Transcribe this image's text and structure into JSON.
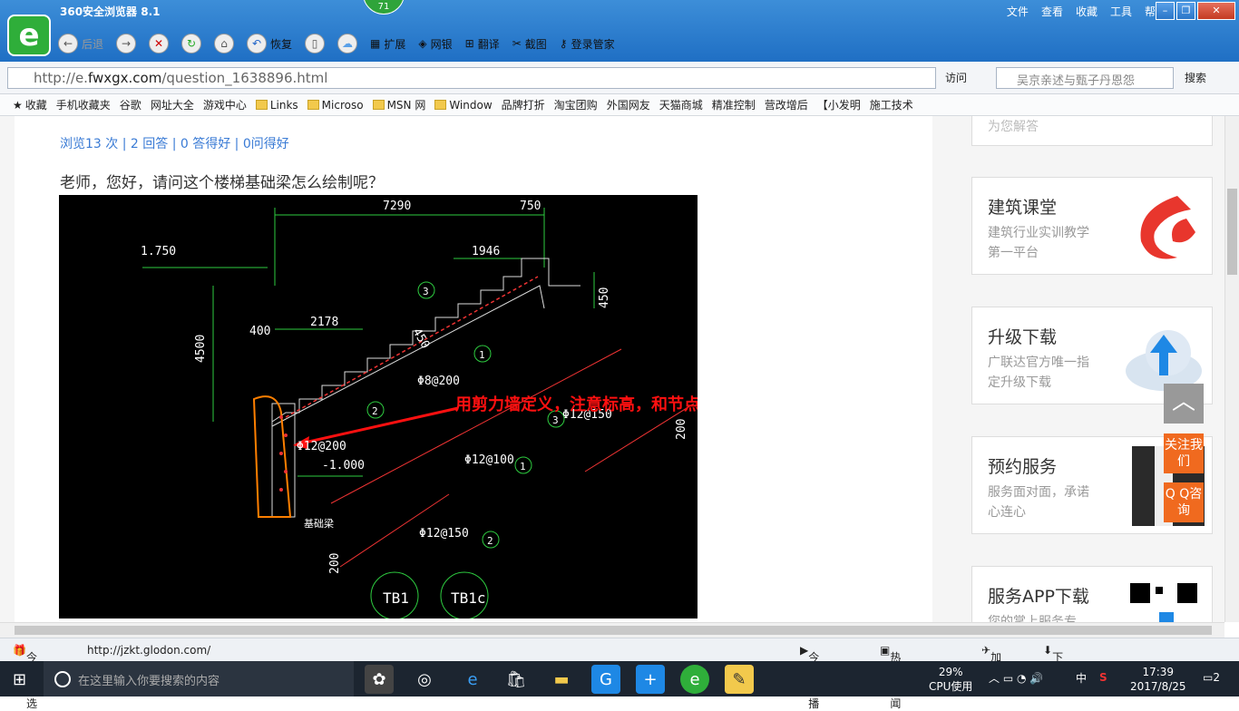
{
  "browser": {
    "title": "360安全浏览器 8.1",
    "badge": "71",
    "menu": [
      "文件",
      "查看",
      "收藏",
      "工具",
      "帮助"
    ],
    "toolbar": {
      "back": "后退",
      "restore": "恢复",
      "extend": "扩展",
      "bank": "网银",
      "translate": "翻译",
      "screenshot": "截图",
      "login": "登录管家"
    },
    "url_domain": "http://e.",
    "url_host": "fwxgx.com",
    "url_path": "/question_1638896.html",
    "visit": "访问",
    "search_placeholder": "吴京亲述与甄子丹恩怨",
    "search_button": "搜索"
  },
  "favorites": [
    "收藏",
    "手机收藏夹",
    "谷歌",
    "网址大全",
    "游戏中心",
    "Links",
    "Microso",
    "MSN 网",
    "Window",
    "品牌打折",
    "淘宝团购",
    "外国网友",
    "天猫商城",
    "精准控制",
    "营改增后",
    "【小发明",
    "施工技术"
  ],
  "question": {
    "stats": "浏览13 次 | 2 回答 | 0 答得好 | 0问得好",
    "text": "老师，您好，请问这个楼梯基础梁怎么绘制呢？"
  },
  "cad": {
    "dim_7290": "7290",
    "dim_750": "750",
    "dim_1946": "1946",
    "dim_2178": "2178",
    "dim_400": "400",
    "dim_4500": "4500",
    "dim_450a": "450",
    "dim_450b": "450",
    "elev_1750": "1.750",
    "elev_neg1": "-1.000",
    "rebar_8_200": "Φ8@200",
    "rebar_12_200": "Φ12@200",
    "rebar_12_150a": "Φ12@150",
    "rebar_12_100": "Φ12@100",
    "rebar_12_150b": "Φ12@150",
    "dim_200a": "200",
    "dim_200b": "200",
    "label_base_beam": "基础梁",
    "annotation": "用剪力墙定义，注意标高，和节点设置",
    "tb1": "TB1",
    "tb1c": "TB1c",
    "circle1": "1",
    "circle2": "2",
    "circle3": "3"
  },
  "sidebar": {
    "partial_text": "为您解答",
    "cards": [
      {
        "title": "建筑课堂",
        "desc": "建筑行业实训教学第一平台"
      },
      {
        "title": "升级下载",
        "desc": "广联达官方唯一指定升级下载"
      },
      {
        "title": "预约服务",
        "desc": "服务面对面，承诺心连心"
      },
      {
        "title": "服务APP下载",
        "desc": "您的掌上服务专"
      }
    ],
    "follow": "关注我们",
    "qq": "Q Q咨询"
  },
  "statusbar": {
    "today": "今日优选",
    "url": "http://jzkt.glodon.com/",
    "live": "今日直播",
    "hotnews": "热点新闻",
    "accel": "加速器",
    "download": "下载"
  },
  "taskbar": {
    "search": "在这里输入你要搜索的内容",
    "cpu_pct": "29%",
    "cpu_label": "CPU使用",
    "ime": "中",
    "time": "17:39",
    "date": "2017/8/25",
    "notif": "2"
  }
}
